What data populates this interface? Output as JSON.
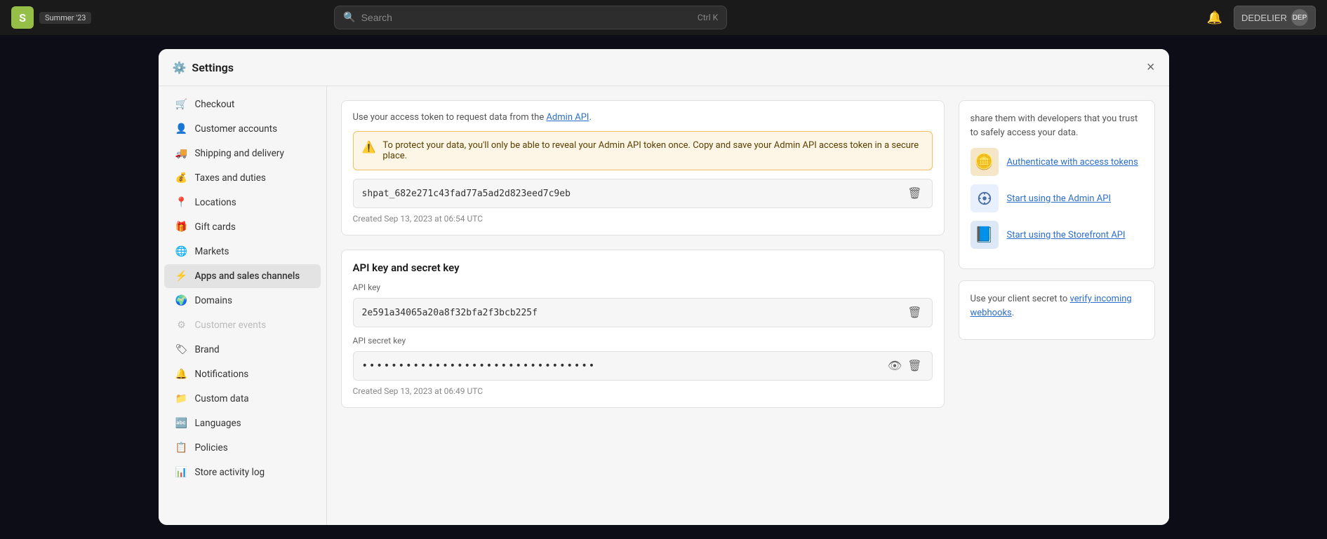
{
  "topbar": {
    "logo_letter": "S",
    "badge_label": "Summer '23",
    "search_placeholder": "Search",
    "search_shortcut": "Ctrl K",
    "bell_icon": "🔔",
    "user_name": "DEDELIER",
    "user_avatar": "DEP"
  },
  "modal": {
    "title": "Settings",
    "close_icon": "×"
  },
  "sidebar": {
    "items": [
      {
        "id": "checkout",
        "label": "Checkout",
        "icon": "🛒"
      },
      {
        "id": "customer-accounts",
        "label": "Customer accounts",
        "icon": "👤"
      },
      {
        "id": "shipping-delivery",
        "label": "Shipping and delivery",
        "icon": "🚚"
      },
      {
        "id": "taxes-duties",
        "label": "Taxes and duties",
        "icon": "💰"
      },
      {
        "id": "locations",
        "label": "Locations",
        "icon": "📍"
      },
      {
        "id": "gift-cards",
        "label": "Gift cards",
        "icon": "🎁"
      },
      {
        "id": "markets",
        "label": "Markets",
        "icon": "🌐"
      },
      {
        "id": "apps-sales-channels",
        "label": "Apps and sales channels",
        "icon": "⚡"
      },
      {
        "id": "domains",
        "label": "Domains",
        "icon": "🌍"
      },
      {
        "id": "customer-events",
        "label": "Customer events",
        "icon": "⚙",
        "disabled": true
      },
      {
        "id": "brand",
        "label": "Brand",
        "icon": "🏷"
      },
      {
        "id": "notifications",
        "label": "Notifications",
        "icon": "🔔"
      },
      {
        "id": "custom-data",
        "label": "Custom data",
        "icon": "📁"
      },
      {
        "id": "languages",
        "label": "Languages",
        "icon": "🔤"
      },
      {
        "id": "policies",
        "label": "Policies",
        "icon": "📋"
      },
      {
        "id": "store-activity-log",
        "label": "Store activity log",
        "icon": "📊"
      }
    ]
  },
  "main": {
    "access_token_card": {
      "description": "Use your access token to request data from the",
      "admin_api_link": "Admin API",
      "admin_api_link_suffix": ".",
      "warning": "To protect your data, you'll only be able to reveal your Admin API token once. Copy and save your Admin API access token in a secure place.",
      "token_value": "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",
      "created_label": "Created Sep 13, 2023 at 06:54 UTC"
    },
    "api_key_card": {
      "title": "API key and secret key",
      "api_key_label": "API key",
      "api_key_value": "2e591a34065a20a8f32bfa2f3bcb225f",
      "api_secret_label": "API secret key",
      "api_secret_dots": "••••••••••••••••••••••••••••••••",
      "api_secret_created": "Created Sep 13, 2023 at 06:49 UTC"
    },
    "right_panel": {
      "intro_text": "share them with developers that you trust to safely access your data.",
      "resources": [
        {
          "icon": "🪙",
          "icon_bg": "#f5e6c8",
          "label": "Authenticate with access tokens"
        },
        {
          "icon": "⚙️",
          "icon_bg": "#e8f0fe",
          "label": "Start using the Admin API"
        },
        {
          "icon": "📘",
          "icon_bg": "#dce8f5",
          "label": "Start using the Storefront API"
        }
      ],
      "webhook_text": "Use your client secret to",
      "webhook_link": "verify incoming webhooks",
      "webhook_suffix": "."
    }
  }
}
